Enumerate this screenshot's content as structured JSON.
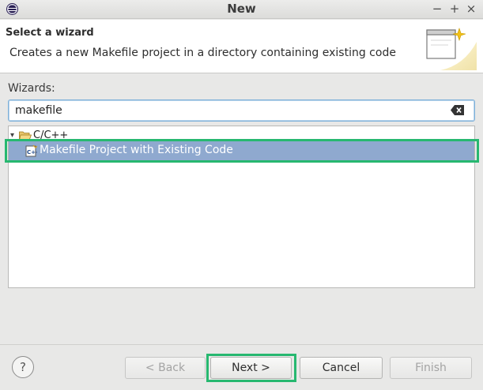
{
  "window": {
    "title": "New",
    "minimize": "−",
    "maximize": "+",
    "close": "×"
  },
  "banner": {
    "title": "Select a wizard",
    "description": "Creates a new Makefile project in a directory containing existing code"
  },
  "wizards": {
    "label": "Wizards:",
    "filter_value": "makefile",
    "tree": {
      "category": "C/C++",
      "items": [
        {
          "label": "Makefile Project with Existing Code",
          "selected": true
        }
      ]
    }
  },
  "footer": {
    "help": "?",
    "back": "< Back",
    "next": "Next >",
    "cancel": "Cancel",
    "finish": "Finish"
  },
  "colors": {
    "selection": "#8fa9cf",
    "highlight_box": "#27b870"
  }
}
